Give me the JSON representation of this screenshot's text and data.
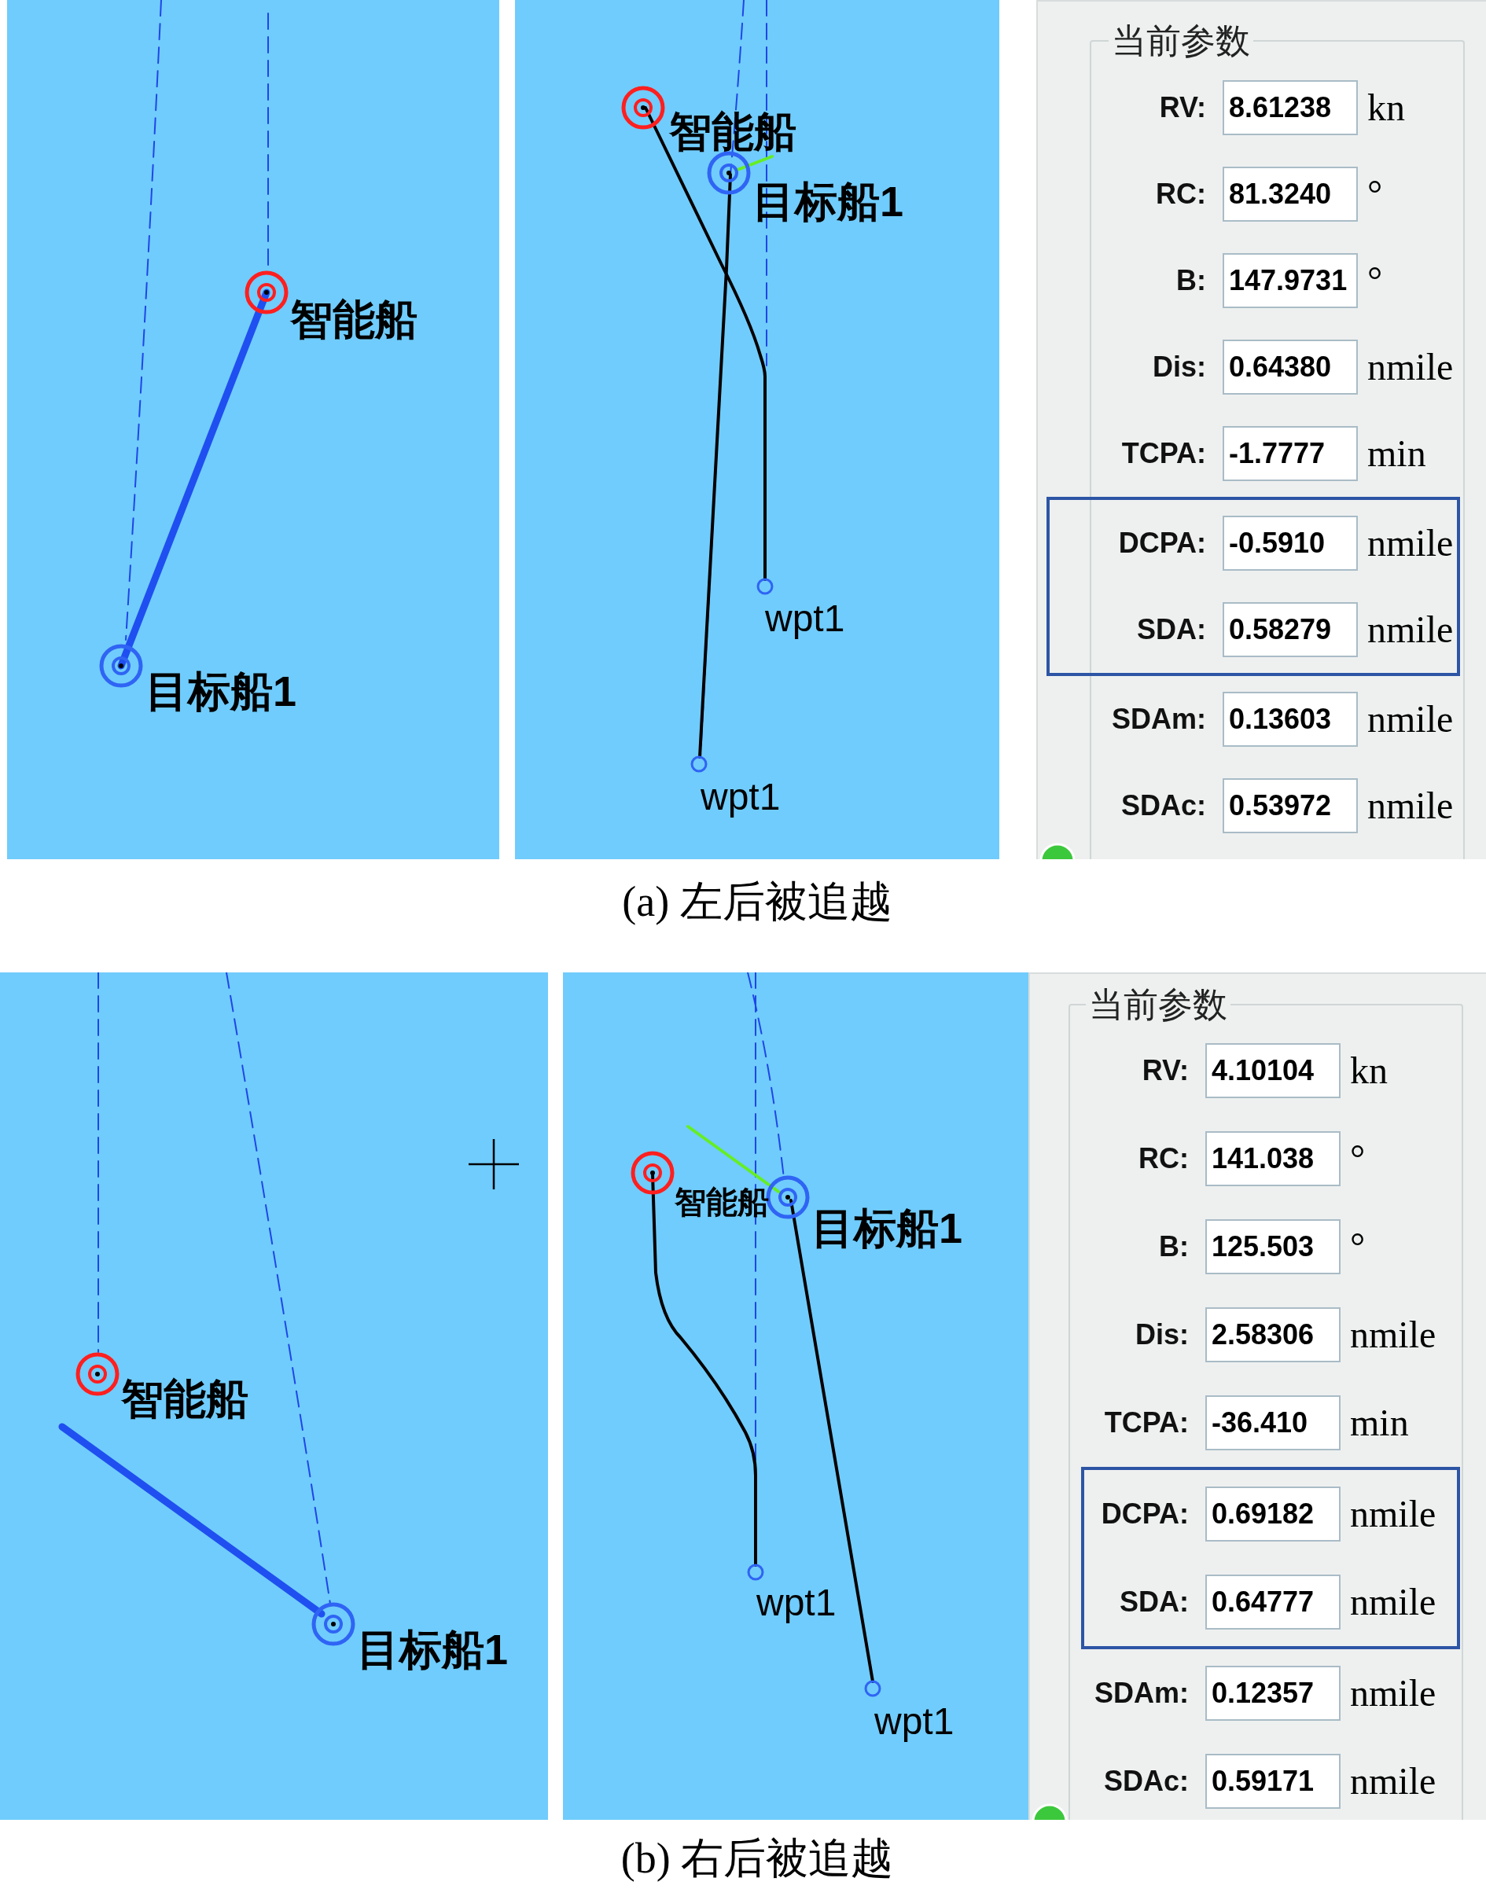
{
  "subfigures": [
    {
      "maps": [
        {
          "labels": [
            {
              "kind": "own_ship",
              "text": "智能船"
            },
            {
              "kind": "target_ship",
              "text": "目标船1"
            }
          ]
        },
        {
          "labels": [
            {
              "kind": "own_ship",
              "text": "智能船"
            },
            {
              "kind": "target_ship",
              "text": "目标船1"
            },
            {
              "kind": "waypoint",
              "text": "wpt1"
            },
            {
              "kind": "waypoint",
              "text": "wpt1"
            }
          ]
        }
      ],
      "parameters": {
        "title": "当前参数",
        "rows": [
          {
            "label": "RV:",
            "value": "8.61238",
            "unit": "kn",
            "highlighted": false
          },
          {
            "label": "RC:",
            "value": "81.3240",
            "unit": "°",
            "highlighted": false
          },
          {
            "label": "B:",
            "value": "147.9731",
            "unit": "°",
            "highlighted": false
          },
          {
            "label": "Dis:",
            "value": "0.64380",
            "unit": "nmile",
            "highlighted": false
          },
          {
            "label": "TCPA:",
            "value": "-1.7777",
            "unit": "min",
            "highlighted": false
          },
          {
            "label": "DCPA:",
            "value": "-0.5910",
            "unit": "nmile",
            "highlighted": true
          },
          {
            "label": "SDA:",
            "value": "0.58279",
            "unit": "nmile",
            "highlighted": true
          },
          {
            "label": "SDAm:",
            "value": "0.13603",
            "unit": "nmile",
            "highlighted": false
          },
          {
            "label": "SDAc:",
            "value": "0.53972",
            "unit": "nmile",
            "highlighted": false
          }
        ]
      },
      "caption": "(a) 左后被追越"
    },
    {
      "maps": [
        {
          "labels": [
            {
              "kind": "own_ship",
              "text": "智能船"
            },
            {
              "kind": "target_ship",
              "text": "目标船1"
            }
          ]
        },
        {
          "labels": [
            {
              "kind": "own_ship",
              "text": "智能船"
            },
            {
              "kind": "target_ship",
              "text": "目标船1"
            },
            {
              "kind": "waypoint",
              "text": "wpt1"
            },
            {
              "kind": "waypoint",
              "text": "wpt1"
            }
          ]
        }
      ],
      "parameters": {
        "title": "当前参数",
        "rows": [
          {
            "label": "RV:",
            "value": "4.10104",
            "unit": "kn",
            "highlighted": false
          },
          {
            "label": "RC:",
            "value": "141.038",
            "unit": "°",
            "highlighted": false
          },
          {
            "label": "B:",
            "value": "125.503",
            "unit": "°",
            "highlighted": false
          },
          {
            "label": "Dis:",
            "value": "2.58306",
            "unit": "nmile",
            "highlighted": false
          },
          {
            "label": "TCPA:",
            "value": "-36.410",
            "unit": "min",
            "highlighted": false
          },
          {
            "label": "DCPA:",
            "value": "0.69182",
            "unit": "nmile",
            "highlighted": true
          },
          {
            "label": "SDA:",
            "value": "0.64777",
            "unit": "nmile",
            "highlighted": true
          },
          {
            "label": "SDAm:",
            "value": "0.12357",
            "unit": "nmile",
            "highlighted": false
          },
          {
            "label": "SDAc:",
            "value": "0.59171",
            "unit": "nmile",
            "highlighted": false
          }
        ]
      },
      "caption": "(b) 右后被追越"
    }
  ]
}
